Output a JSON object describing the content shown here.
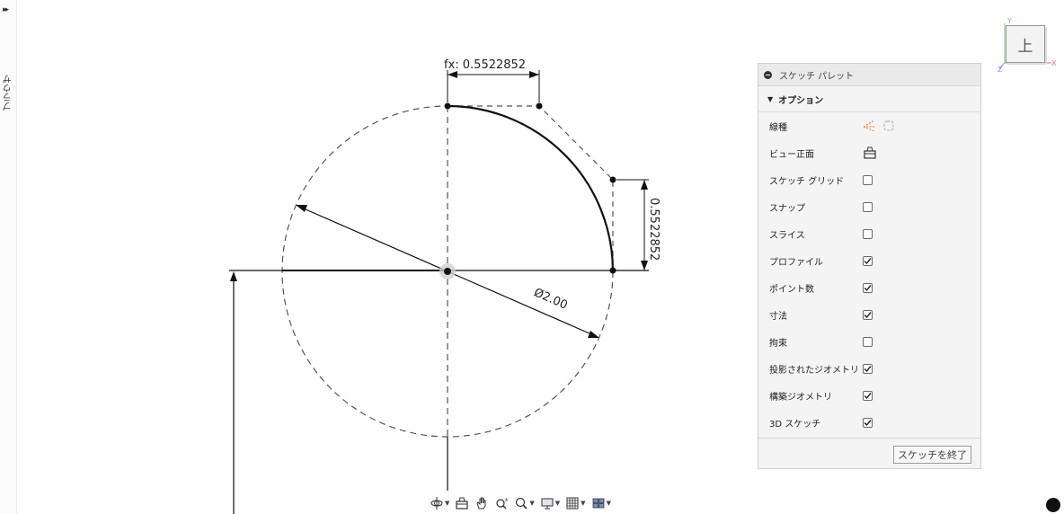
{
  "browser": {
    "tab_label": "ブラウザ",
    "expand_glyph": "▸▸"
  },
  "canvas": {
    "dimension_horizontal": "fx: 0.5522852",
    "dimension_vertical": "0.5522852",
    "dimension_diameter": "Ø2.00"
  },
  "viewcube": {
    "face_label": "上",
    "axis_x": "X",
    "axis_y": "Y",
    "axis_z": "Z"
  },
  "palette": {
    "title": "スケッチ パレット",
    "section": "オプション",
    "rows": [
      {
        "label": "線種",
        "type": "icons"
      },
      {
        "label": "ビュー正面",
        "type": "icon"
      },
      {
        "label": "スケッチ グリッド",
        "type": "checkbox",
        "checked": false
      },
      {
        "label": "スナップ",
        "type": "checkbox",
        "checked": false
      },
      {
        "label": "スライス",
        "type": "checkbox",
        "checked": false
      },
      {
        "label": "プロファイル",
        "type": "checkbox",
        "checked": true
      },
      {
        "label": "ポイント数",
        "type": "checkbox",
        "checked": true
      },
      {
        "label": "寸法",
        "type": "checkbox",
        "checked": true
      },
      {
        "label": "拘束",
        "type": "checkbox",
        "checked": false
      },
      {
        "label": "投影されたジオメトリ",
        "type": "checkbox",
        "checked": true
      },
      {
        "label": "構築ジオメトリ",
        "type": "checkbox",
        "checked": true
      },
      {
        "label": "3D スケッチ",
        "type": "checkbox",
        "checked": true
      }
    ],
    "finish_label": "スケッチを終了"
  },
  "toolbar": {
    "items": [
      "orbit-icon",
      "look-at-icon",
      "pan-icon",
      "zoom-icon",
      "zoom-window-icon",
      "display-settings-icon",
      "grid-settings-icon",
      "viewports-icon"
    ]
  },
  "colors": {
    "line": "#111111",
    "construction": "#555555",
    "palette_bg": "#f4f4f4",
    "accent_orange": "#e07a2e"
  }
}
